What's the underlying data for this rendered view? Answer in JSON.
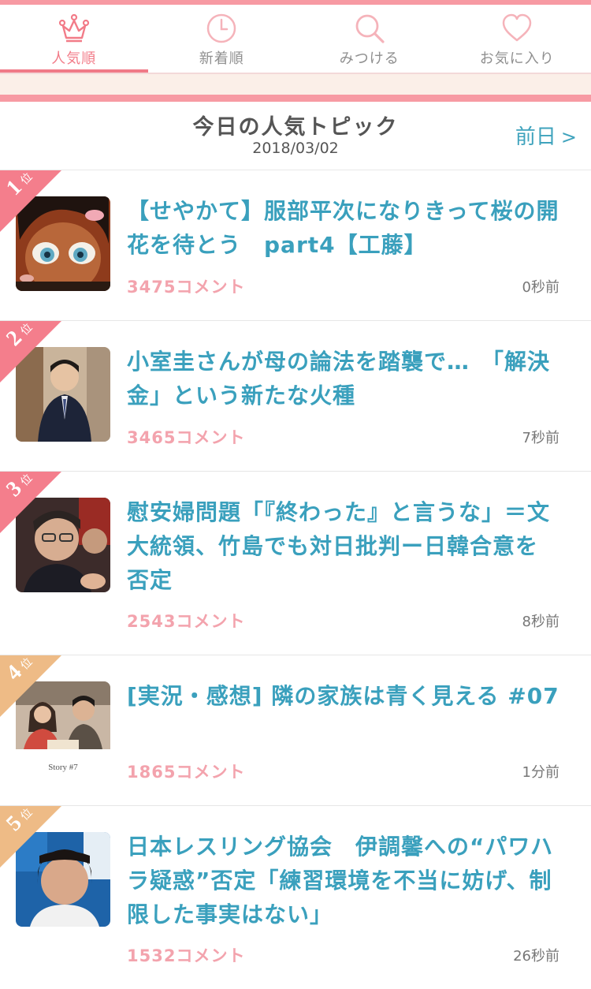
{
  "tabs": [
    {
      "label": "人気順",
      "icon": "crown-icon",
      "active": true
    },
    {
      "label": "新着順",
      "icon": "clock-icon",
      "active": false
    },
    {
      "label": "みつける",
      "icon": "search-icon",
      "active": false
    },
    {
      "label": "お気に入り",
      "icon": "heart-icon",
      "active": false
    }
  ],
  "header": {
    "title": "今日の人気トピック",
    "date": "2018/03/02",
    "prev_label": "前日"
  },
  "colors": {
    "accent_pink": "#f79aa3",
    "title_blue": "#3aa0bd",
    "comment_pink": "#f3a3ad",
    "rank_top3": "#f47e8c",
    "rank_other": "#eebb86"
  },
  "topics": [
    {
      "rank": "1",
      "rank_suffix": "位",
      "title": "【せやかて】服部平次になりきって桜の開花を待とう　part4【工藤】",
      "comments": "3475コメント",
      "time": "0秒前"
    },
    {
      "rank": "2",
      "rank_suffix": "位",
      "title": "小室圭さんが母の論法を踏襲で…　「解決金」という新たな火種",
      "comments": "3465コメント",
      "time": "7秒前"
    },
    {
      "rank": "3",
      "rank_suffix": "位",
      "title": "慰安婦問題「『終わった』と言うな」＝文大統領、竹島でも対日批判ー日韓合意を否定",
      "comments": "2543コメント",
      "time": "8秒前"
    },
    {
      "rank": "4",
      "rank_suffix": "位",
      "title": "[実況・感想] 隣の家族は青く見える #07",
      "comments": "1865コメント",
      "time": "1分前",
      "thumb_text": "Story #7"
    },
    {
      "rank": "5",
      "rank_suffix": "位",
      "title": "日本レスリング協会　伊調馨への“パワハラ疑惑”否定「練習環境を不当に妨げ、制限した事実はない」",
      "comments": "1532コメント",
      "time": "26秒前"
    }
  ]
}
